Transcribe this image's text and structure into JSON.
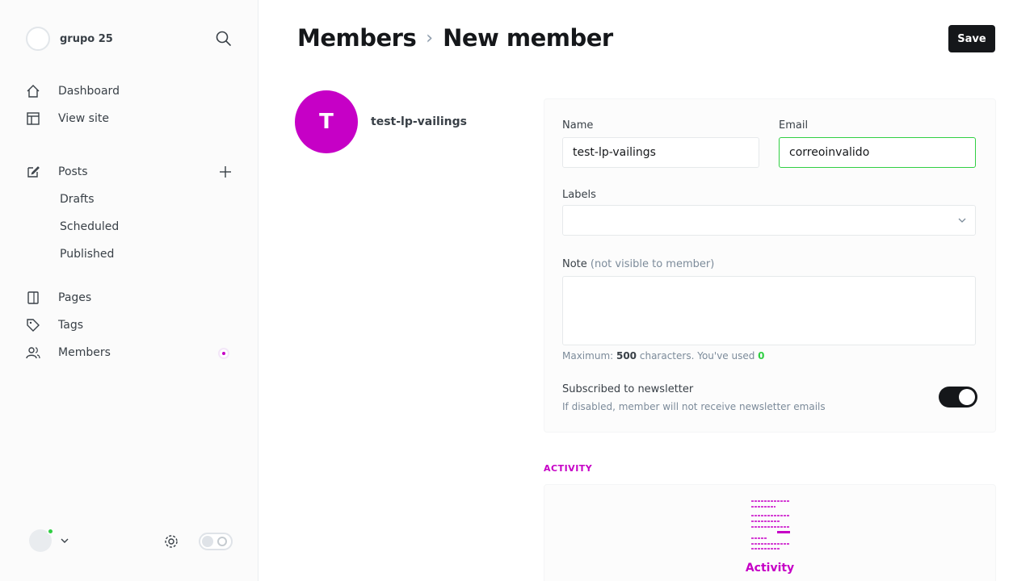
{
  "site": {
    "name": "grupo 25"
  },
  "nav": {
    "dashboard": "Dashboard",
    "view_site": "View site",
    "posts": "Posts",
    "drafts": "Drafts",
    "scheduled": "Scheduled",
    "published": "Published",
    "pages": "Pages",
    "tags": "Tags",
    "members": "Members"
  },
  "header": {
    "breadcrumb_parent": "Members",
    "breadcrumb_separator": "›",
    "breadcrumb_current": "New member",
    "save_label": "Save"
  },
  "member": {
    "initial": "T",
    "display_name": "test-lp-vailings"
  },
  "form": {
    "name_label": "Name",
    "name_value": "test-lp-vailings",
    "email_label": "Email",
    "email_value": "correoinvalido",
    "labels_label": "Labels",
    "note_label": "Note",
    "note_sublabel": "(not visible to member)",
    "note_hint_prefix": "Maximum: ",
    "note_hint_max": "500",
    "note_hint_mid": " characters. You've used ",
    "note_hint_used": "0",
    "subscribed_title": "Subscribed to newsletter",
    "subscribed_desc": "If disabled, member will not receive newsletter emails",
    "subscribed": true
  },
  "activity": {
    "heading": "ACTIVITY",
    "empty_label": "Activity"
  },
  "colors": {
    "accent": "#c600c6",
    "error_border": "#30cf43",
    "dark": "#15171a"
  },
  "icons": [
    "search-icon",
    "home-icon",
    "view-site-icon",
    "edit-icon",
    "plus-icon",
    "page-icon",
    "tag-icon",
    "members-icon",
    "chevron-down-icon",
    "gear-icon",
    "moon-icon"
  ]
}
